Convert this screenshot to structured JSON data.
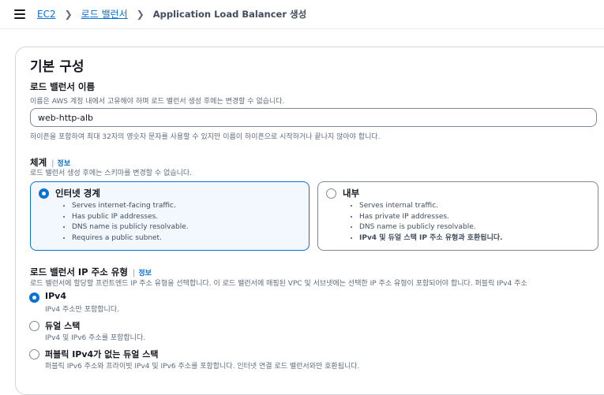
{
  "breadcrumb": {
    "items": [
      "EC2",
      "로드 밸런서"
    ],
    "current": "Application Load Balancer 생성"
  },
  "section": {
    "title": "기본 구성"
  },
  "name_field": {
    "label": "로드 밸런서 이름",
    "description": "이름은 AWS 계정 내에서 고유해야 하며 로드 밸런서 생성 후에는 변경할 수 없습니다.",
    "value": "web-http-alb",
    "constraint": "하이픈을 포함하여 최대 32자의 영숫자 문자를 사용할 수 있지만 이름이 하이픈으로 시작하거나 끝나지 않아야 합니다."
  },
  "scheme": {
    "label": "체계",
    "info": "정보",
    "description": "로드 밸런서 생성 후에는 스키마를 변경할 수 없습니다.",
    "options": [
      {
        "title": "인터넷 경계",
        "selected": true,
        "bullets": [
          "Serves internet-facing traffic.",
          "Has public IP addresses.",
          "DNS name is publicly resolvable.",
          "Requires a public subnet."
        ]
      },
      {
        "title": "내부",
        "selected": false,
        "bullets": [
          "Serves internal traffic.",
          "Has private IP addresses.",
          "DNS name is publicly resolvable.",
          "IPv4 및 듀얼 스택 IP 주소 유형과 호환됩니다."
        ]
      }
    ]
  },
  "ip_type": {
    "label": "로드 밸런서 IP 주소 유형",
    "info": "정보",
    "description": "로드 밸런서에 할당할 프런트엔드 IP 주소 유형을 선택합니다. 이 로드 밸런서에 매핑된 VPC 및 서브넷에는 선택한 IP 주소 유형이 포함되어야 합니다. 퍼블릭 IPv4 주소",
    "options": [
      {
        "label": "IPv4",
        "desc": "IPv4 주소만 포함합니다.",
        "selected": true
      },
      {
        "label": "듀얼 스택",
        "desc": "IPv4 및 IPv6 주소를 포함합니다.",
        "selected": false
      },
      {
        "label": "퍼블릭 IPv4가 없는 듀얼 스택",
        "desc": "퍼블릭 IPv6 주소와 프라이빗 IPv4 및 IPv6 주소를 포함합니다. 인터넷 연결 로드 밸런서와만 호환됩니다.",
        "selected": false
      }
    ]
  },
  "colors": {
    "accent": "#0972d3",
    "selected_bg": "#f2f8fd",
    "border": "#7d8998"
  }
}
